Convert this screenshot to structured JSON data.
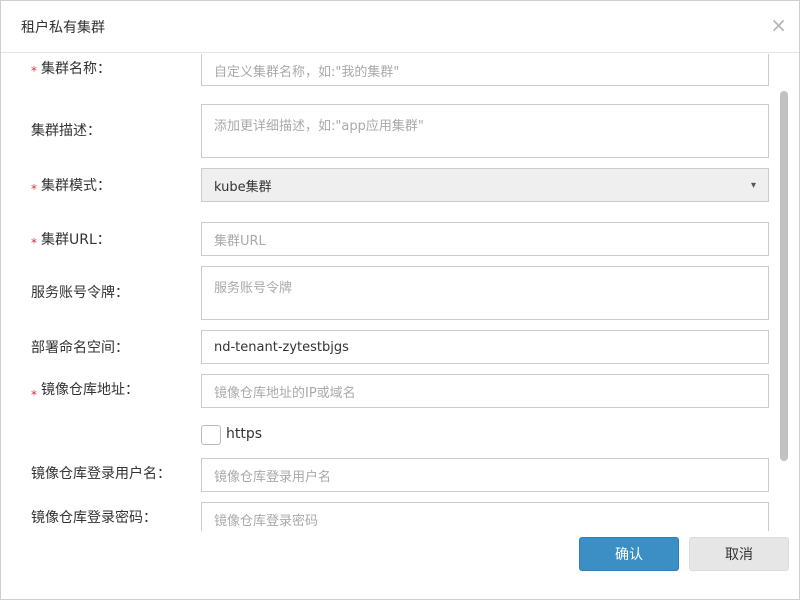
{
  "dialog": {
    "title": "租户私有集群",
    "close_symbol": "×"
  },
  "form": {
    "required_mark": "*",
    "name": {
      "label": "集群名称：",
      "placeholder": "自定义集群名称，如:\"我的集群\""
    },
    "description": {
      "label": "集群描述：",
      "placeholder": "添加更详细描述，如:\"app应用集群\""
    },
    "mode": {
      "label": "集群模式：",
      "value": "kube集群"
    },
    "url": {
      "label": "集群URL：",
      "placeholder": "集群URL"
    },
    "token": {
      "label": "服务账号令牌：",
      "placeholder": "服务账号令牌"
    },
    "namespace": {
      "label": "部署命名空间：",
      "value": "nd-tenant-zytestbjgs"
    },
    "registry": {
      "label": "镜像仓库地址：",
      "placeholder": "镜像仓库地址的IP或域名"
    },
    "https": {
      "label": "https",
      "checked": false
    },
    "registry_user": {
      "label": "镜像仓库登录用户名：",
      "placeholder": "镜像仓库登录用户名"
    },
    "registry_password": {
      "label": "镜像仓库登录密码：",
      "placeholder": "镜像仓库登录密码"
    }
  },
  "footer": {
    "confirm_label": "确认",
    "cancel_label": "取消"
  },
  "colors": {
    "confirm_bg": "#3b8fc4",
    "required": "#d9363e"
  }
}
